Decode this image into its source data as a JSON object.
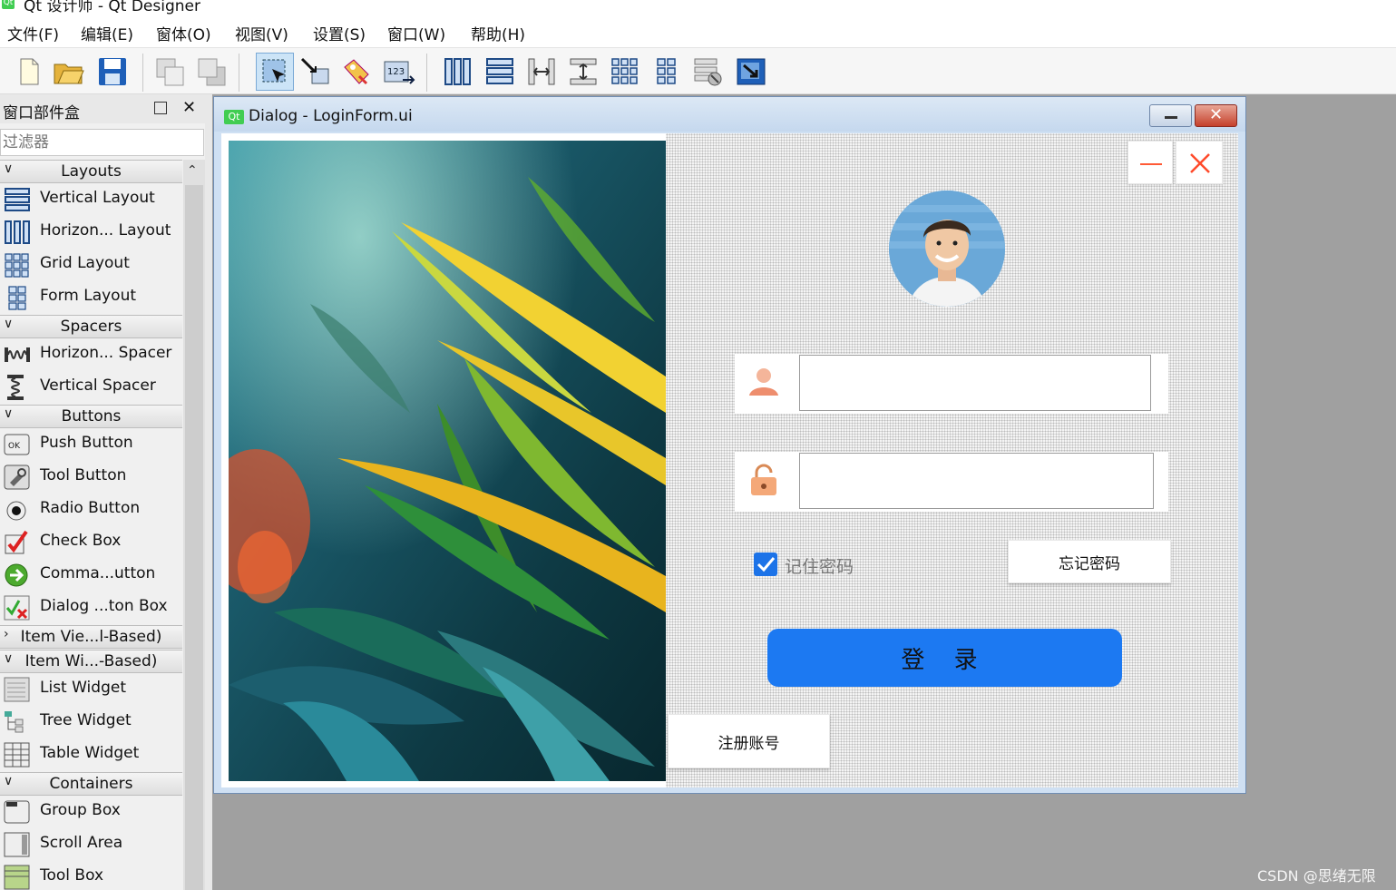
{
  "app": {
    "title": "Qt 设计师 - Qt Designer",
    "logo": "Qt"
  },
  "menu": [
    "文件(F)",
    "编辑(E)",
    "窗体(O)",
    "视图(V)",
    "设置(S)",
    "窗口(W)",
    "帮助(H)"
  ],
  "toolbar": {
    "buttons": [
      "new-file-icon",
      "open-folder-icon",
      "save-icon",
      "send-to-back-icon",
      "bring-to-front-icon",
      "edit-widgets-icon",
      "edit-signals-slots-icon",
      "edit-buddies-icon",
      "edit-tab-order-icon",
      "lay-out-horizontally-icon",
      "lay-out-vertically-icon",
      "lay-out-horizontal-splitter-icon",
      "lay-out-vertical-splitter-icon",
      "lay-out-grid-icon",
      "lay-out-form-icon",
      "break-layout-icon",
      "adjust-size-icon"
    ],
    "active": "edit-widgets-icon"
  },
  "widgetbox": {
    "title": "窗口部件盒",
    "filter_placeholder": "过滤器",
    "sections": [
      {
        "label": "Layouts",
        "expanded": true,
        "items": [
          "Vertical Layout",
          "Horizon... Layout",
          "Grid Layout",
          "Form Layout"
        ]
      },
      {
        "label": "Spacers",
        "expanded": true,
        "items": [
          "Horizon... Spacer",
          "Vertical Spacer"
        ]
      },
      {
        "label": "Buttons",
        "expanded": true,
        "items": [
          "Push Button",
          "Tool Button",
          "Radio Button",
          "Check Box",
          "Comma...utton",
          "Dialog ...ton Box"
        ]
      },
      {
        "label": "Item Vie...l-Based)",
        "expanded": false,
        "items": []
      },
      {
        "label": "Item Wi...-Based)",
        "expanded": true,
        "items": [
          "List Widget",
          "Tree Widget",
          "Table Widget"
        ]
      },
      {
        "label": "Containers",
        "expanded": true,
        "items": [
          "Group Box",
          "Scroll Area",
          "Tool Box"
        ]
      }
    ]
  },
  "dialog": {
    "title": "Dialog - LoginForm.ui",
    "username_value": "",
    "password_value": "",
    "remember_label": "记住密码",
    "remember_checked": true,
    "forgot_label": "忘记密码",
    "login_label": "登 录",
    "register_label": "注册账号",
    "accent": "#1c79f2"
  },
  "watermark": "CSDN @思绪无限"
}
